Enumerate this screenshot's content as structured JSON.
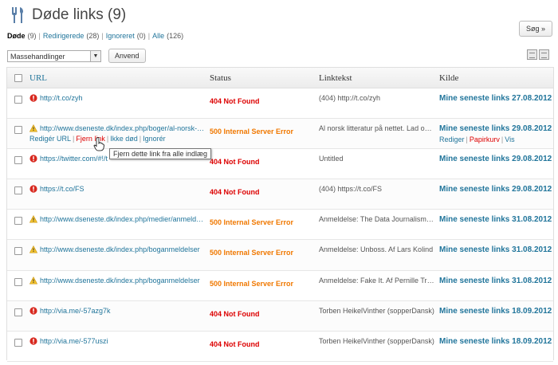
{
  "header": {
    "title": "Døde links (9)",
    "search_label": "Søg »"
  },
  "filters": [
    {
      "label": "Døde",
      "count": "(9)",
      "active": true
    },
    {
      "label": "Redirigerede",
      "count": "(28)",
      "active": false
    },
    {
      "label": "Ignoreret",
      "count": "(0)",
      "active": false
    },
    {
      "label": "Alle",
      "count": "(126)",
      "active": false
    }
  ],
  "bulk": {
    "selected": "Massehandlinger",
    "apply_label": "Anvend"
  },
  "columns": {
    "url": "URL",
    "status": "Status",
    "text": "Linktekst",
    "source": "Kilde"
  },
  "row_actions": {
    "edit": "Redigér URL",
    "unlink": "Fjern link",
    "not_broken": "Ikke død",
    "ignore": "Ignorér"
  },
  "source_actions": {
    "edit": "Rediger",
    "trash": "Papirkurv",
    "view": "Vis"
  },
  "tooltip": "Fjern dette link fra alle indlæg",
  "rows": [
    {
      "icon": "error",
      "url": "http://t.co/zyh",
      "status": "404 Not Found",
      "code": "404",
      "text": "(404) http://t.co/zyh",
      "source": "Mine seneste links 27.08.2012"
    },
    {
      "icon": "warning",
      "url": "http://www.dseneste.dk/index.php/boger/al-norsk-litteratur",
      "status": "500 Internal Server Error",
      "code": "500",
      "text": "Al norsk litteratur på nettet. Lad os blot",
      "source": "Mine seneste links 29.08.2012",
      "expanded": true
    },
    {
      "icon": "error",
      "url": "https://twitter.com/#!/t",
      "status": "404 Not Found",
      "code": "404",
      "text": "Untitled",
      "source": "Mine seneste links 29.08.2012"
    },
    {
      "icon": "error",
      "url": "https://t.co/FS",
      "status": "404 Not Found",
      "code": "404",
      "text": "(404) https://t.co/FS",
      "source": "Mine seneste links 29.08.2012"
    },
    {
      "icon": "warning",
      "url": "http://www.dseneste.dk/index.php/medier/anmeldelse",
      "status": "500 Internal Server Error",
      "code": "500",
      "text": "Anmeldelse: The Data Journalism Handbook",
      "source": "Mine seneste links 31.08.2012"
    },
    {
      "icon": "warning",
      "url": "http://www.dseneste.dk/index.php/boganmeldelser",
      "status": "500 Internal Server Error",
      "code": "500",
      "text": "Anmeldelse: Unboss. Af Lars Kolind",
      "source": "Mine seneste links 31.08.2012"
    },
    {
      "icon": "warning",
      "url": "http://www.dseneste.dk/index.php/boganmeldelser",
      "status": "500 Internal Server Error",
      "code": "500",
      "text": "Anmeldelse: Fake It. Af Pernille Tranberg",
      "source": "Mine seneste links 31.08.2012"
    },
    {
      "icon": "error",
      "url": "http://via.me/-57azg7k",
      "status": "404 Not Found",
      "code": "404",
      "text": "Torben HeikelVinther (sopperDansk)",
      "source": "Mine seneste links 18.09.2012"
    },
    {
      "icon": "error",
      "url": "http://via.me/-577uszi",
      "status": "404 Not Found",
      "code": "404",
      "text": "Torben HeikelVinther (sopperDansk)",
      "source": "Mine seneste links 18.09.2012"
    }
  ]
}
